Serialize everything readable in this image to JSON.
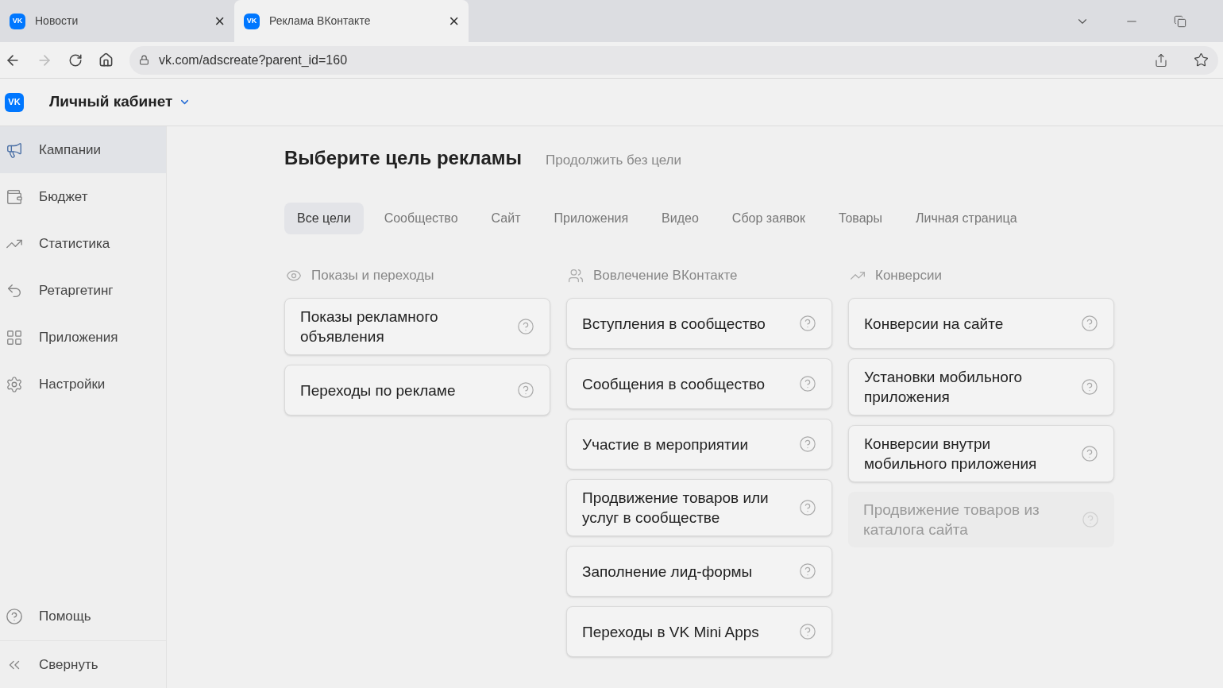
{
  "browser": {
    "tabs": [
      {
        "logo": "VK",
        "title": "Новости",
        "close": "×",
        "selected": false
      },
      {
        "logo": "VK",
        "title": "Реклама ВКонтакте",
        "close": "×",
        "selected": true
      }
    ],
    "address": "vk.com/adscreate?parent_id=160"
  },
  "header": {
    "logo": "VK",
    "title": "Личный кабинет"
  },
  "sidebar": {
    "items": [
      {
        "kind": "megaphone",
        "label": "Кампании",
        "selected": true
      },
      {
        "kind": "wallet",
        "label": "Бюджет",
        "selected": false
      },
      {
        "kind": "chart",
        "label": "Статистика",
        "selected": false
      },
      {
        "kind": "undo",
        "label": "Ретаргетинг",
        "selected": false
      },
      {
        "kind": "apps",
        "label": "Приложения",
        "selected": false
      },
      {
        "kind": "gear",
        "label": "Настройки",
        "selected": false
      }
    ],
    "bottom": [
      {
        "kind": "help",
        "label": "Помощь"
      },
      {
        "kind": "collapse",
        "label": "Свернуть"
      }
    ]
  },
  "main": {
    "title": "Выберите цель рекламы",
    "skip_link": "Продолжить без цели",
    "filters": [
      {
        "label": "Все цели",
        "selected": true
      },
      {
        "label": "Сообщество",
        "selected": false
      },
      {
        "label": "Сайт",
        "selected": false
      },
      {
        "label": "Приложения",
        "selected": false
      },
      {
        "label": "Видео",
        "selected": false
      },
      {
        "label": "Сбор заявок",
        "selected": false
      },
      {
        "label": "Товары",
        "selected": false
      },
      {
        "label": "Личная страница",
        "selected": false
      }
    ],
    "groups": [
      {
        "kind": "eye",
        "title": "Показы и переходы",
        "goals": [
          {
            "label": "Показы рекламного объявления",
            "disabled": false
          },
          {
            "label": "Переходы по рекламе",
            "disabled": false
          }
        ]
      },
      {
        "kind": "people",
        "title": "Вовлечение ВКонтакте",
        "goals": [
          {
            "label": "Вступления в сообщество",
            "disabled": false
          },
          {
            "label": "Сообщения в сообщество",
            "disabled": false
          },
          {
            "label": "Участие в мероприятии",
            "disabled": false
          },
          {
            "label": "Продвижение товаров или услуг в сообществе",
            "disabled": false
          },
          {
            "label": "Заполнение лид-формы",
            "disabled": false
          },
          {
            "label": "Переходы в VK Mini Apps",
            "disabled": false
          }
        ]
      },
      {
        "kind": "chart",
        "title": "Конверсии",
        "goals": [
          {
            "label": "Конверсии на сайте",
            "disabled": false
          },
          {
            "label": "Установки мобильного приложения",
            "disabled": false
          },
          {
            "label": "Конверсии внутри мобильного приложения",
            "disabled": false
          },
          {
            "label": "Продвижение товаров из каталога сайта",
            "disabled": true
          }
        ]
      }
    ]
  }
}
